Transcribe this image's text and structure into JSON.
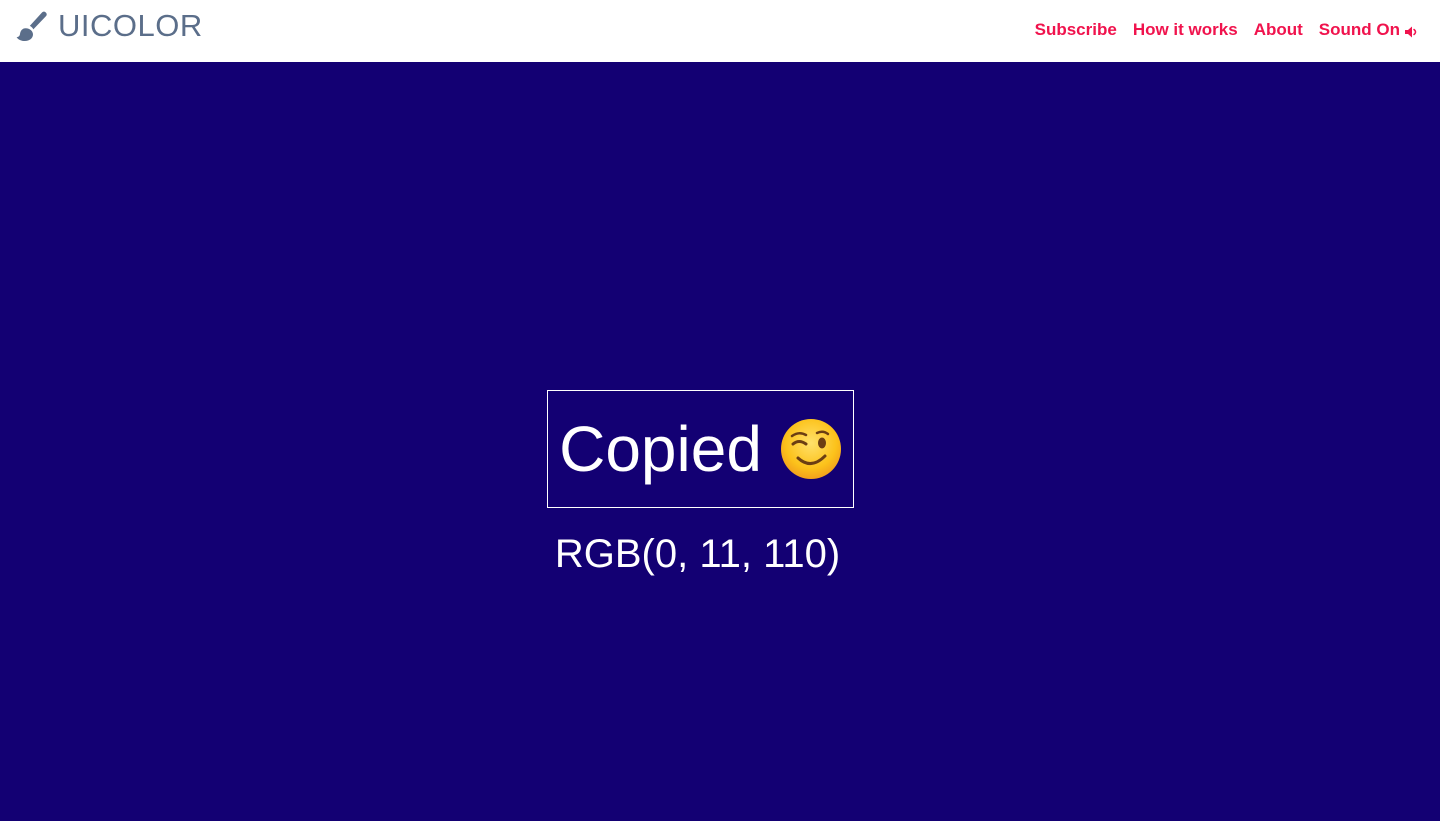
{
  "header": {
    "logo_text": "UICOLOR",
    "logo_icon": "paintbrush-icon",
    "nav": [
      {
        "label": "Subscribe"
      },
      {
        "label": "How it works"
      },
      {
        "label": "About"
      },
      {
        "label": "Sound On",
        "icon": "speaker-icon"
      }
    ]
  },
  "main": {
    "background_color": "#130073",
    "copied_label": "Copied",
    "copied_icon": "winking-face-icon",
    "rgb_value": "RGB(0, 11, 110)"
  },
  "colors": {
    "accent": "#f0134d",
    "logo": "#5b6e8a",
    "text_on_bg": "#ffffff"
  }
}
